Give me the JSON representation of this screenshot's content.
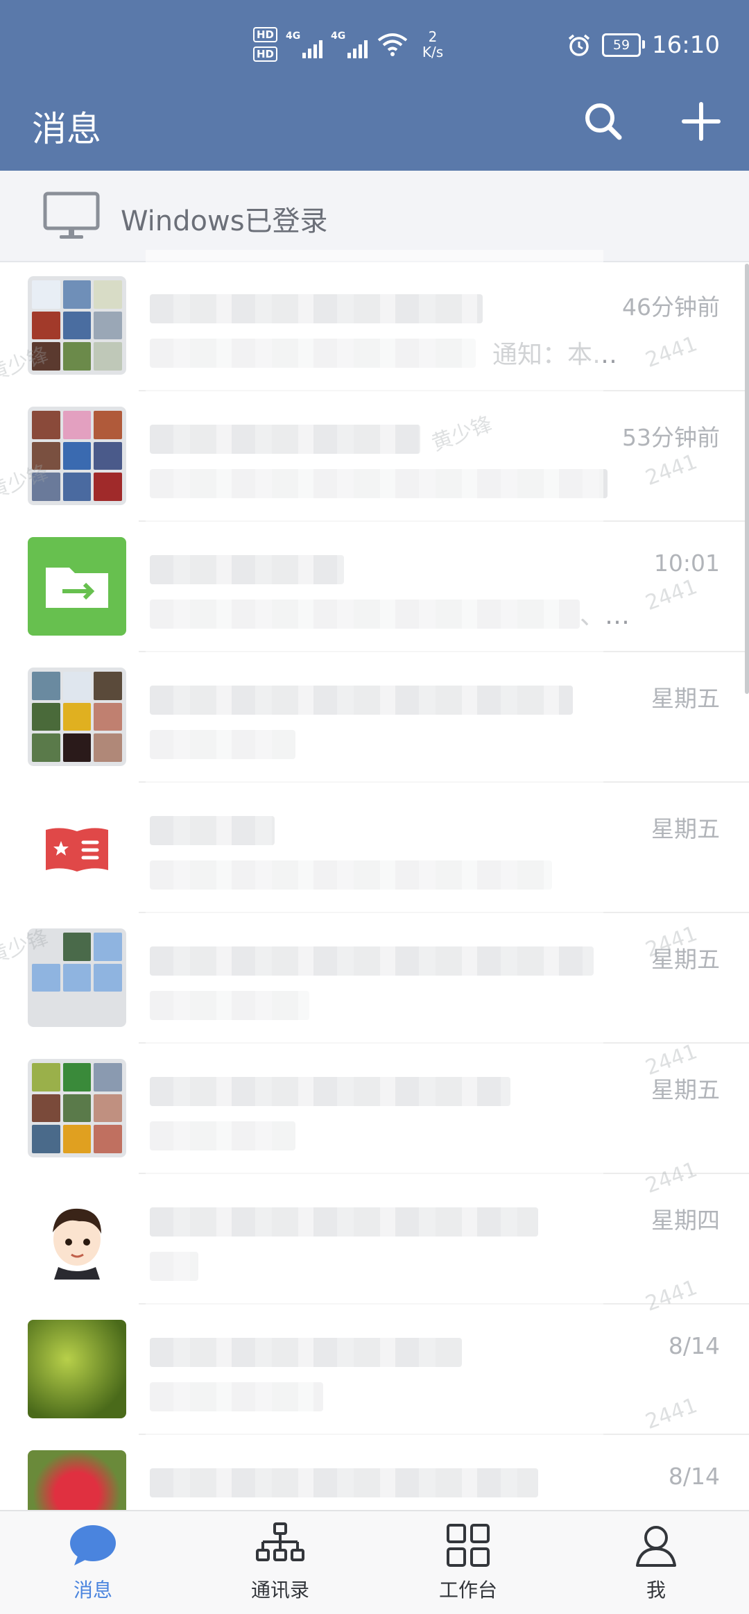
{
  "status_bar": {
    "hd1": "HD",
    "hd2": "HD",
    "network1": "4G",
    "network2": "4G",
    "speed_value": "2",
    "speed_unit": "K/s",
    "battery": "59",
    "time": "16:10"
  },
  "header": {
    "title": "消息",
    "search_icon": "search-icon",
    "add_icon": "plus-icon"
  },
  "login_banner": {
    "icon": "monitor-icon",
    "text": "Windows已登录"
  },
  "conversations": [
    {
      "avatar": "group-grid",
      "name": "",
      "preview_tail": "通知：本…",
      "time": "46分钟前"
    },
    {
      "avatar": "group-grid",
      "name": "",
      "preview_tail": "",
      "time": "53分钟前"
    },
    {
      "avatar": "folder-icon",
      "name": "",
      "preview_tail": "、…",
      "time": "10:01"
    },
    {
      "avatar": "group-grid",
      "name": "",
      "preview_tail": "",
      "time": "星期五"
    },
    {
      "avatar": "book-icon",
      "name": "",
      "preview_tail": "",
      "time": "星期五"
    },
    {
      "avatar": "group-placeholder",
      "name": "",
      "preview_tail": "",
      "time": "星期五"
    },
    {
      "avatar": "group-grid",
      "name": "",
      "preview_tail": "",
      "time": "星期五"
    },
    {
      "avatar": "cartoon-avatar",
      "name": "",
      "preview_tail": "",
      "time": "星期四"
    },
    {
      "avatar": "leaf-photo",
      "name": "",
      "preview_tail": "",
      "time": "8/14"
    },
    {
      "avatar": "flower-photo",
      "name": "",
      "preview_tail": "",
      "time": "8/14"
    }
  ],
  "watermark": {
    "name": "黄少锋",
    "code": "2441"
  },
  "bottom_nav": [
    {
      "label": "消息",
      "icon": "chat-bubble-icon",
      "active": true
    },
    {
      "label": "通讯录",
      "icon": "org-chart-icon",
      "active": false
    },
    {
      "label": "工作台",
      "icon": "grid-icon",
      "active": false
    },
    {
      "label": "我",
      "icon": "person-icon",
      "active": false
    }
  ],
  "colors": {
    "header": "#5a79aa",
    "active_tab": "#4a84de",
    "time_text": "#b1b4b9"
  }
}
